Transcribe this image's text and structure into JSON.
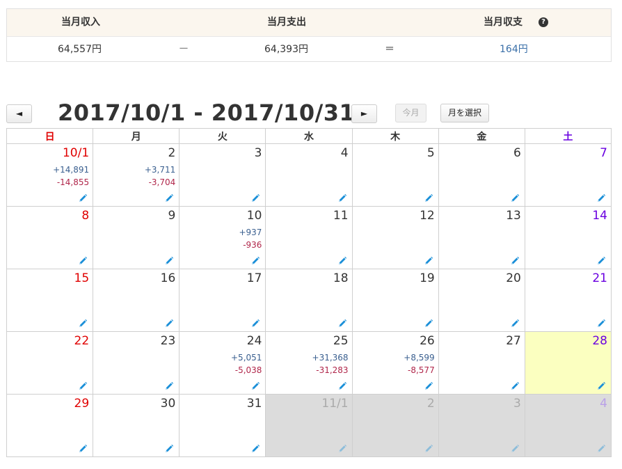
{
  "summary": {
    "income_label": "当月収入",
    "expense_label": "当月支出",
    "balance_label": "当月収支",
    "income_value": "64,557円",
    "minus_sign": "ー",
    "expense_value": "64,393円",
    "equals_sign": "＝",
    "balance_value": "164円",
    "help_glyph": "?"
  },
  "nav": {
    "prev_label": "◄",
    "next_label": "►",
    "range_title": "2017/10/1 - 2017/10/31",
    "today_label": "今月",
    "select_month_label": "月を選択"
  },
  "weekdays": [
    "日",
    "月",
    "火",
    "水",
    "木",
    "金",
    "土"
  ],
  "weeks": [
    [
      {
        "day": "10/1",
        "income": "+14,891",
        "expense": "-14,855"
      },
      {
        "day": "2",
        "income": "+3,711",
        "expense": "-3,704"
      },
      {
        "day": "3"
      },
      {
        "day": "4"
      },
      {
        "day": "5"
      },
      {
        "day": "6"
      },
      {
        "day": "7"
      }
    ],
    [
      {
        "day": "8"
      },
      {
        "day": "9"
      },
      {
        "day": "10",
        "income": "+937",
        "expense": "-936"
      },
      {
        "day": "11"
      },
      {
        "day": "12"
      },
      {
        "day": "13"
      },
      {
        "day": "14"
      }
    ],
    [
      {
        "day": "15"
      },
      {
        "day": "16"
      },
      {
        "day": "17"
      },
      {
        "day": "18"
      },
      {
        "day": "19"
      },
      {
        "day": "20"
      },
      {
        "day": "21"
      }
    ],
    [
      {
        "day": "22"
      },
      {
        "day": "23"
      },
      {
        "day": "24",
        "income": "+5,051",
        "expense": "-5,038"
      },
      {
        "day": "25",
        "income": "+31,368",
        "expense": "-31,283"
      },
      {
        "day": "26",
        "income": "+8,599",
        "expense": "-8,577"
      },
      {
        "day": "27"
      },
      {
        "day": "28",
        "today": true
      }
    ],
    [
      {
        "day": "29"
      },
      {
        "day": "30"
      },
      {
        "day": "31"
      },
      {
        "day": "11/1",
        "other": true
      },
      {
        "day": "2",
        "other": true
      },
      {
        "day": "3",
        "other": true
      },
      {
        "day": "4",
        "other": true
      }
    ]
  ],
  "colors": {
    "income": "#3a5f8f",
    "expense": "#b0264a",
    "sunday": "#e00000",
    "saturday": "#6a00e0",
    "today_bg": "#fbffc0",
    "other_month_bg": "#dcdcdc",
    "pencil": "#1a8fd8",
    "balance": "#3a6fa8"
  },
  "icons": {
    "edit": "pencil-icon",
    "help": "question-circle-icon"
  }
}
